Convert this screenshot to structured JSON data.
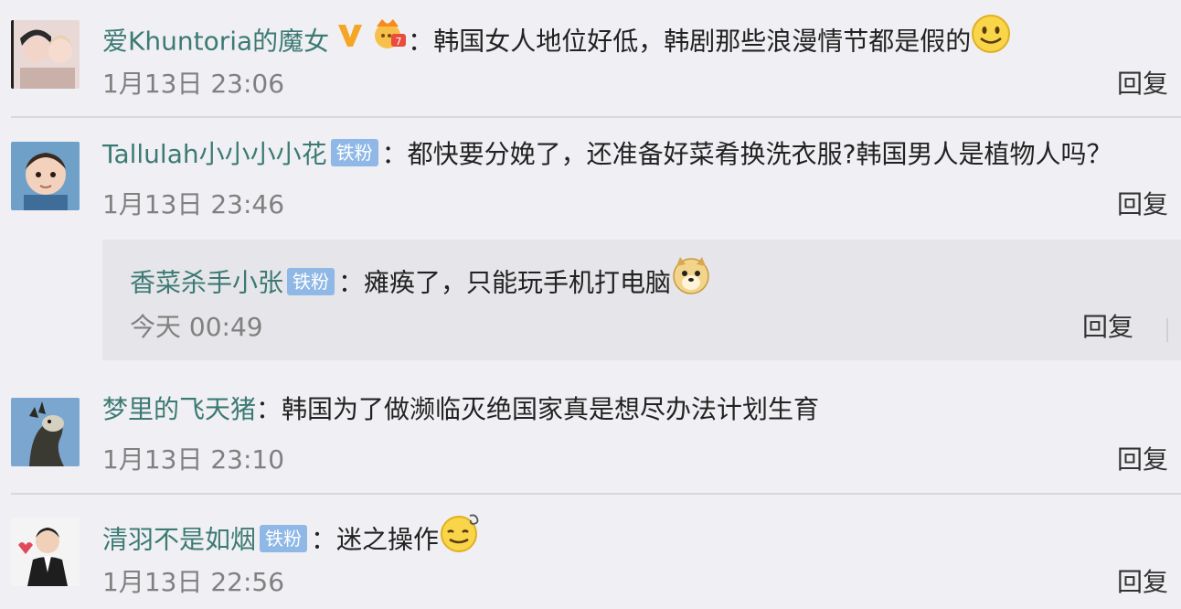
{
  "comments": [
    {
      "name": "爱Khuntoria的魔女",
      "colon": "：",
      "text": "韩国女人地位好低，韩剧那些浪漫情节都是假的",
      "time": "1月13日 23:06",
      "reply": "回复"
    },
    {
      "name": "Tallulah小小小小花",
      "badge": "铁粉",
      "colon": "：",
      "text": "都快要分娩了，还准备好菜肴换洗衣服?韩国男人是植物人吗？",
      "time": "1月13日 23:46",
      "reply": "回复",
      "sub_reply": {
        "name": "香菜杀手小张",
        "badge": "铁粉",
        "colon": "：",
        "text": "瘫痪了，只能玩手机打电脑",
        "time": "今天 00:49",
        "reply": "回复"
      }
    },
    {
      "name": "梦里的飞天猪",
      "colon": "：",
      "text": "韩国为了做濒临灭绝国家真是想尽办法计划生育",
      "time": "1月13日 23:10",
      "reply": "回复"
    },
    {
      "name": "清羽不是如烟",
      "badge": "铁粉",
      "colon": "：",
      "text": "迷之操作",
      "time": "1月13日 22:56",
      "reply": "回复"
    }
  ],
  "colors": {
    "name": "#3c7a74",
    "badge": "#8fb8e6",
    "meta": "#808080",
    "background": "#f0f0f4"
  },
  "icons": [
    "verified-v-icon",
    "member-crown-icon",
    "smile-emoji",
    "doge-emoji",
    "dizzy-emoji"
  ]
}
